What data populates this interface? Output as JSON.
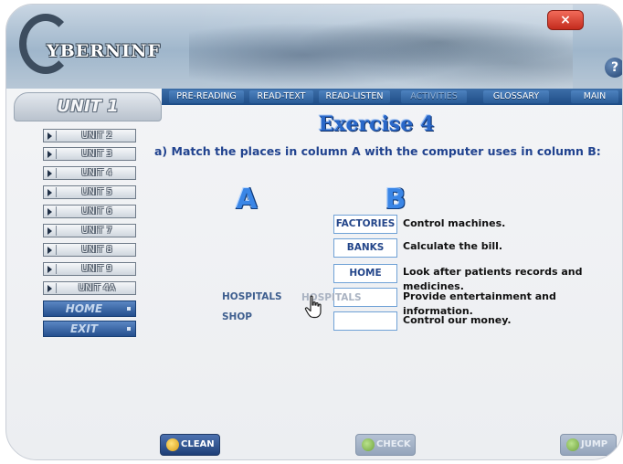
{
  "app": {
    "logo_text": "YBERNINF"
  },
  "window_controls": {
    "close_label": "×",
    "help_label": "?"
  },
  "nav": {
    "tabs": [
      {
        "label": "PRE-READING",
        "enabled": true
      },
      {
        "label": "READ-TEXT",
        "enabled": true
      },
      {
        "label": "READ-LISTEN",
        "enabled": true
      },
      {
        "label": "ACTIVITIES",
        "enabled": false
      },
      {
        "label": "GLOSSARY",
        "enabled": true
      },
      {
        "label": "MAIN",
        "enabled": true
      }
    ]
  },
  "sidebar": {
    "unit_title": "UNIT 1",
    "items": [
      {
        "label": "UNIT 2"
      },
      {
        "label": "UNIT 3"
      },
      {
        "label": "UNIT 4"
      },
      {
        "label": "UNIT 5"
      },
      {
        "label": "UNIT 6"
      },
      {
        "label": "UNIT 7"
      },
      {
        "label": "UNIT 8"
      },
      {
        "label": "UNIT 9"
      },
      {
        "label": "UNIT 4A"
      }
    ],
    "home_label": "HOME",
    "exit_label": "EXIT"
  },
  "exercise": {
    "title": "Exercise 4",
    "instruction": "a) Match the places in column A with the computer uses in column B:",
    "column_a_label": "A",
    "column_b_label": "B",
    "places": [
      "HOSPITALS",
      "SHOP"
    ],
    "rows": [
      {
        "answer": "FACTORIES",
        "use": "Control machines."
      },
      {
        "answer": "BANKS",
        "use": "Calculate the bill."
      },
      {
        "answer": "HOME",
        "use": "Look after patients records and medicines."
      },
      {
        "answer": "",
        "use": "Provide entertainment and information."
      },
      {
        "answer": "",
        "use": "Control our money."
      }
    ],
    "dragging_item": "HOSPITALS"
  },
  "buttons": {
    "clean_label": "CLEAN",
    "check_label": "CHECK",
    "jump_label": "JUMP"
  },
  "colors": {
    "accent_blue": "#2a68c9",
    "nav_blue": "#1d4c86",
    "close_red": "#c32b1d"
  }
}
